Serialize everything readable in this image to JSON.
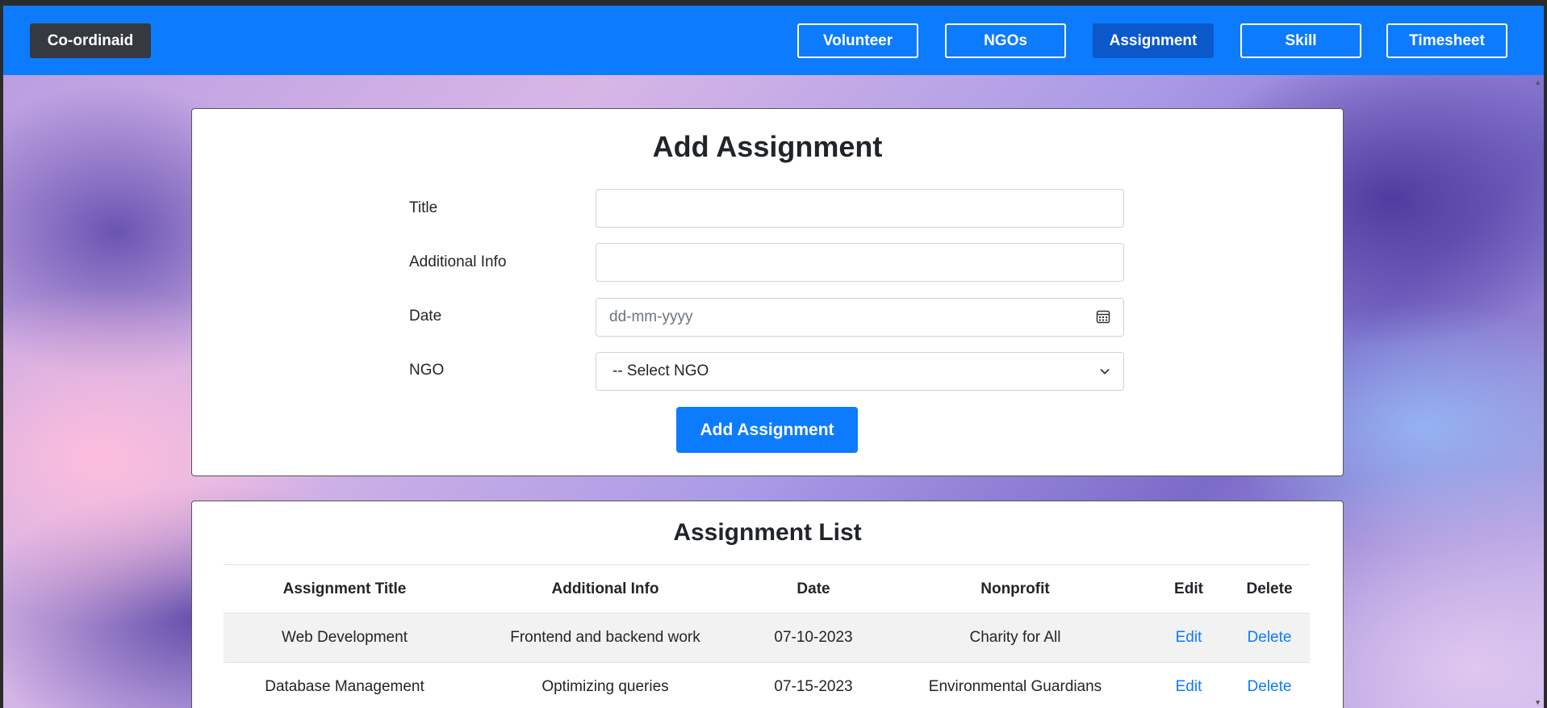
{
  "navbar": {
    "brand": "Co-ordinaid",
    "items": [
      {
        "label": "Volunteer"
      },
      {
        "label": "NGOs"
      },
      {
        "label": "Assignment"
      },
      {
        "label": "Skill"
      },
      {
        "label": "Timesheet"
      }
    ],
    "active": "Assignment"
  },
  "form": {
    "title": "Add Assignment",
    "fields": {
      "title_label": "Title",
      "title_value": "",
      "info_label": "Additional Info",
      "info_value": "",
      "date_label": "Date",
      "date_placeholder": "dd-mm-yyyy",
      "ngo_label": "NGO",
      "ngo_selected": "-- Select NGO"
    },
    "submit_label": "Add Assignment"
  },
  "list": {
    "title": "Assignment List",
    "columns": [
      "Assignment Title",
      "Additional Info",
      "Date",
      "Nonprofit",
      "Edit",
      "Delete"
    ],
    "rows": [
      {
        "title": "Web Development",
        "info": "Frontend and backend work",
        "date": "07-10-2023",
        "ngo": "Charity for All",
        "edit": "Edit",
        "delete": "Delete"
      },
      {
        "title": "Database Management",
        "info": "Optimizing queries",
        "date": "07-15-2023",
        "ngo": "Environmental Guardians",
        "edit": "Edit",
        "delete": "Delete"
      }
    ]
  },
  "colors": {
    "primary": "#0d7bfd",
    "active_nav": "#0a58ca",
    "brand_bg": "#343a40"
  },
  "icons": {
    "date": "calendar-icon",
    "select": "chevron-down-icon"
  }
}
